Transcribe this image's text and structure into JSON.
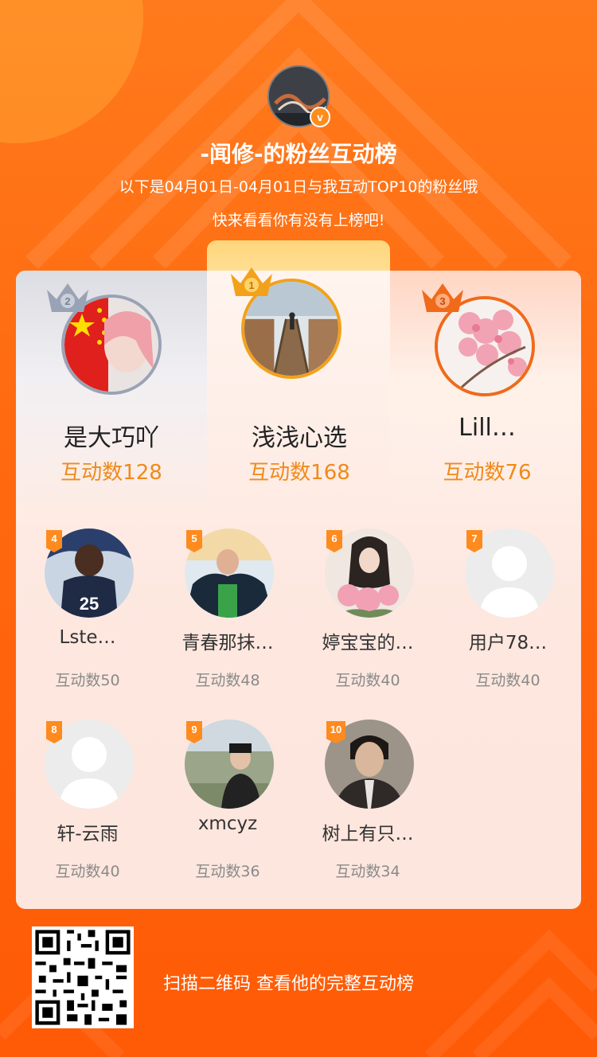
{
  "header": {
    "host_avatar": "host-avatar",
    "verified_mark": "v",
    "title": "-闻修-的粉丝互动榜",
    "subtitle_line1": "以下是04月01日-04月01日与我互动TOP10的粉丝哦",
    "subtitle_line2": "快来看看你有没有上榜吧!"
  },
  "podium": [
    {
      "rank": 2,
      "name": "是大巧吖",
      "score": "互动数128"
    },
    {
      "rank": 1,
      "name": "浅浅心选",
      "score": "互动数168"
    },
    {
      "rank": 3,
      "name": "Lill…",
      "score": "互动数76"
    }
  ],
  "list": [
    {
      "rank": "4",
      "name": "Lste…",
      "score": "互动数50"
    },
    {
      "rank": "5",
      "name": "青春那抹…",
      "score": "互动数48"
    },
    {
      "rank": "6",
      "name": "婷宝宝的…",
      "score": "互动数40"
    },
    {
      "rank": "7",
      "name": "用户78…",
      "score": "互动数40"
    },
    {
      "rank": "8",
      "name": "轩-云雨",
      "score": "互动数40"
    },
    {
      "rank": "9",
      "name": "xmcyz",
      "score": "互动数36"
    },
    {
      "rank": "10",
      "name": "树上有只…",
      "score": "互动数34"
    }
  ],
  "footer": {
    "text": "扫描二维码 查看他的完整互动榜"
  },
  "colors": {
    "accent": "#ff6a10",
    "score": "#f08a1a",
    "silver": "#9aa3b5",
    "gold": "#f2a11a",
    "bronze": "#f06a1a"
  }
}
